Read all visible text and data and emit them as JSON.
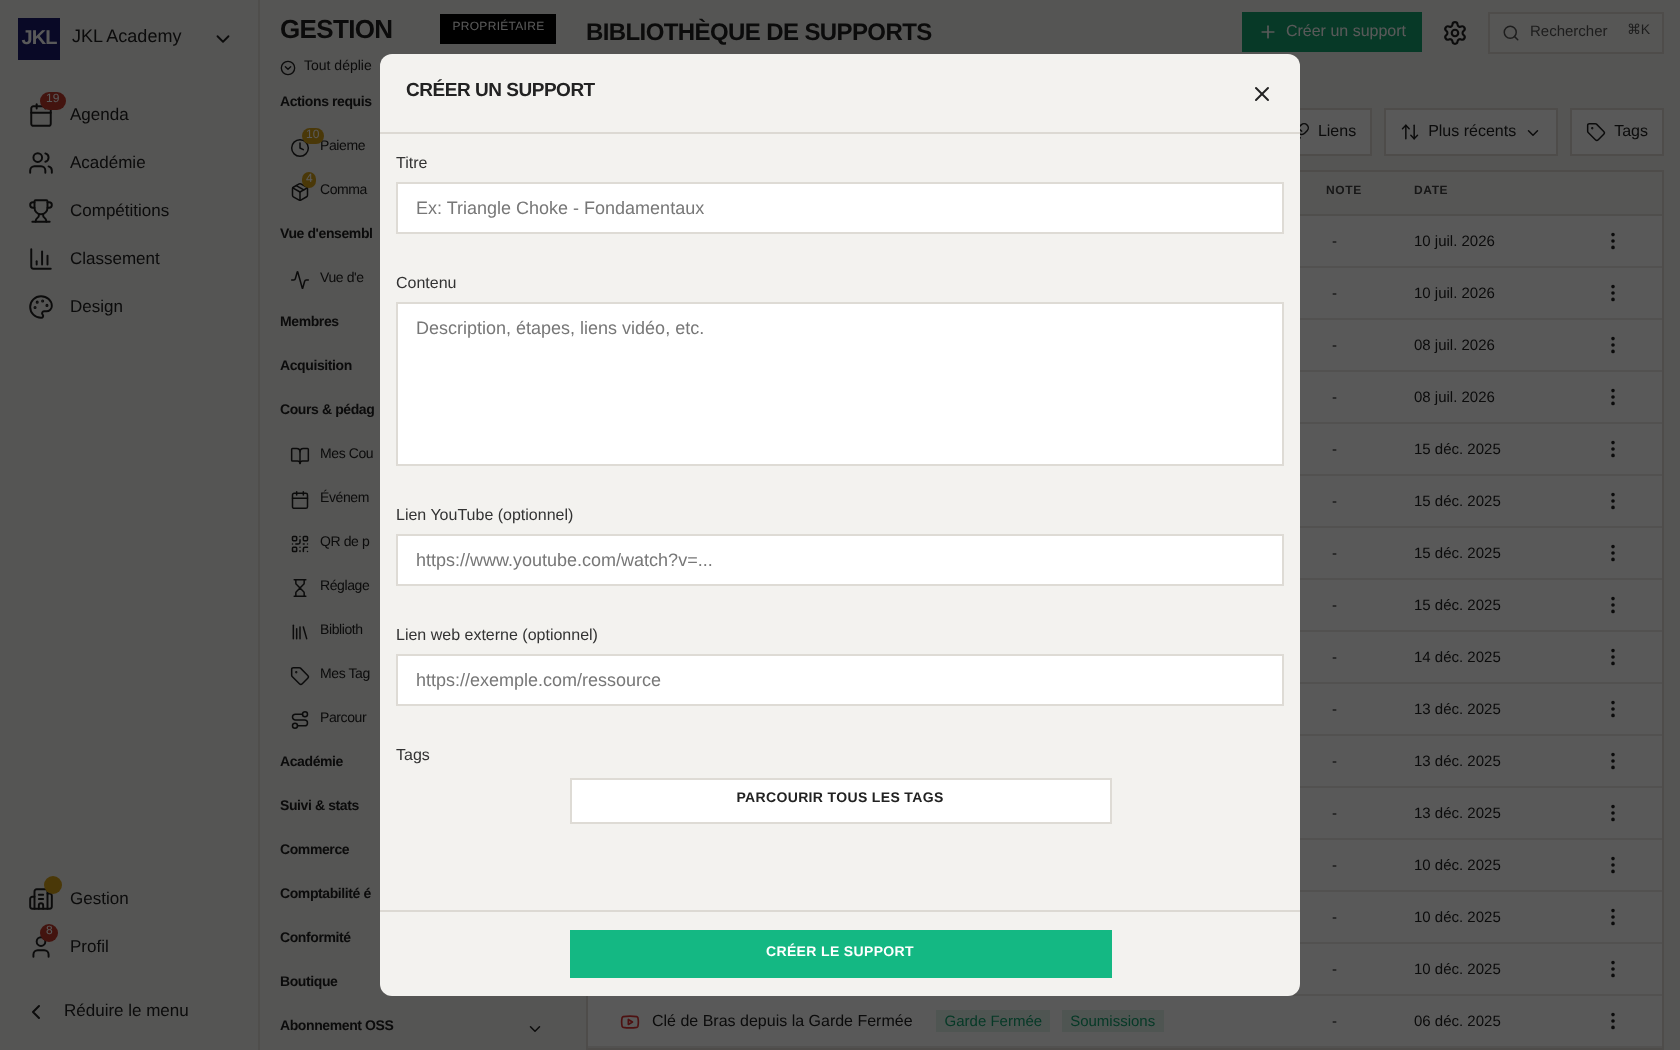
{
  "sidebar": {
    "brand": {
      "logo": "JKL",
      "name": "JKL Academy"
    },
    "items": [
      {
        "label": "Agenda",
        "badge": "19"
      },
      {
        "label": "Académie"
      },
      {
        "label": "Compétitions"
      },
      {
        "label": "Classement"
      },
      {
        "label": "Design"
      }
    ],
    "bottom_items": [
      {
        "label": "Gestion",
        "badge_dot": true
      },
      {
        "label": "Profil",
        "badge": "8"
      }
    ],
    "collapse": "Réduire le menu"
  },
  "subnav": {
    "title": "GESTION",
    "role": "PROPRIÉTAIRE",
    "expand_all": "Tout déplie",
    "items": [
      {
        "kind": "section",
        "label": "Actions requis"
      },
      {
        "kind": "item",
        "label": "Paieme",
        "badge": "10"
      },
      {
        "kind": "item",
        "label": "Comma",
        "badge": "4"
      },
      {
        "kind": "section",
        "label": "Vue d'ensembl"
      },
      {
        "kind": "item",
        "label": "Vue d'e"
      },
      {
        "kind": "section",
        "label": "Membres"
      },
      {
        "kind": "section",
        "label": "Acquisition"
      },
      {
        "kind": "section",
        "label": "Cours & pédag"
      },
      {
        "kind": "item",
        "label": "Mes Cou"
      },
      {
        "kind": "item",
        "label": "Événem"
      },
      {
        "kind": "item",
        "label": "QR de p"
      },
      {
        "kind": "item",
        "label": "Réglage"
      },
      {
        "kind": "item",
        "label": "Biblioth"
      },
      {
        "kind": "item",
        "label": "Mes Tag"
      },
      {
        "kind": "item",
        "label": "Parcour"
      },
      {
        "kind": "section",
        "label": "Académie"
      },
      {
        "kind": "section",
        "label": "Suivi & stats"
      },
      {
        "kind": "section",
        "label": "Commerce"
      },
      {
        "kind": "section",
        "label": "Comptabilité é"
      },
      {
        "kind": "section",
        "label": "Conformité"
      },
      {
        "kind": "section",
        "label": "Boutique"
      },
      {
        "kind": "section",
        "label": "Abonnement OSS",
        "expandable": true
      }
    ]
  },
  "main": {
    "title": "BIBLIOTHÈQUE DE SUPPORTS",
    "create_button": "Créer un support",
    "search": {
      "placeholder": "Rechercher",
      "shortcut": "⌘K"
    },
    "toolbar": [
      {
        "label": "Liens"
      },
      {
        "label": "Plus récents",
        "dropdown": true
      },
      {
        "label": "Tags"
      }
    ],
    "table": {
      "columns": [
        "NOTE",
        "DATE"
      ],
      "rows": [
        {
          "note": "-",
          "date": "10 juil. 2026"
        },
        {
          "note": "-",
          "date": "10 juil. 2026"
        },
        {
          "note": "-",
          "date": "08 juil. 2026"
        },
        {
          "note": "-",
          "date": "08 juil. 2026"
        },
        {
          "note": "-",
          "date": "15 déc. 2025"
        },
        {
          "note": "-",
          "date": "15 déc. 2025"
        },
        {
          "note": "-",
          "date": "15 déc. 2025"
        },
        {
          "note": "-",
          "date": "15 déc. 2025"
        },
        {
          "note": "-",
          "date": "14 déc. 2025"
        },
        {
          "note": "-",
          "date": "13 déc. 2025"
        },
        {
          "note": "-",
          "date": "13 déc. 2025"
        },
        {
          "note": "-",
          "date": "13 déc. 2025"
        },
        {
          "note": "-",
          "date": "10 déc. 2025"
        },
        {
          "note": "-",
          "date": "10 déc. 2025"
        },
        {
          "note": "-",
          "date": "10 déc. 2025"
        },
        {
          "title": "Clé de Bras depuis la Garde Fermée",
          "tags": [
            "Garde Fermée",
            "Soumissions"
          ],
          "note": "-",
          "date": "06 déc. 2025"
        }
      ]
    }
  },
  "modal": {
    "title": "CRÉER UN SUPPORT",
    "fields": [
      {
        "kind": "input",
        "label": "Titre",
        "placeholder": "Ex: Triangle Choke - Fondamentaux"
      },
      {
        "kind": "textarea",
        "label": "Contenu",
        "placeholder": "Description, étapes, liens vidéo, etc."
      },
      {
        "kind": "input",
        "label": "Lien YouTube (optionnel)",
        "placeholder": "https://www.youtube.com/watch?v=..."
      },
      {
        "kind": "input",
        "label": "Lien web externe (optionnel)",
        "placeholder": "https://exemple.com/ressource"
      },
      {
        "kind": "button",
        "label": "Tags",
        "button": "PARCOURIR TOUS LES TAGS"
      }
    ],
    "submit": "CRÉER LE SUPPORT"
  }
}
